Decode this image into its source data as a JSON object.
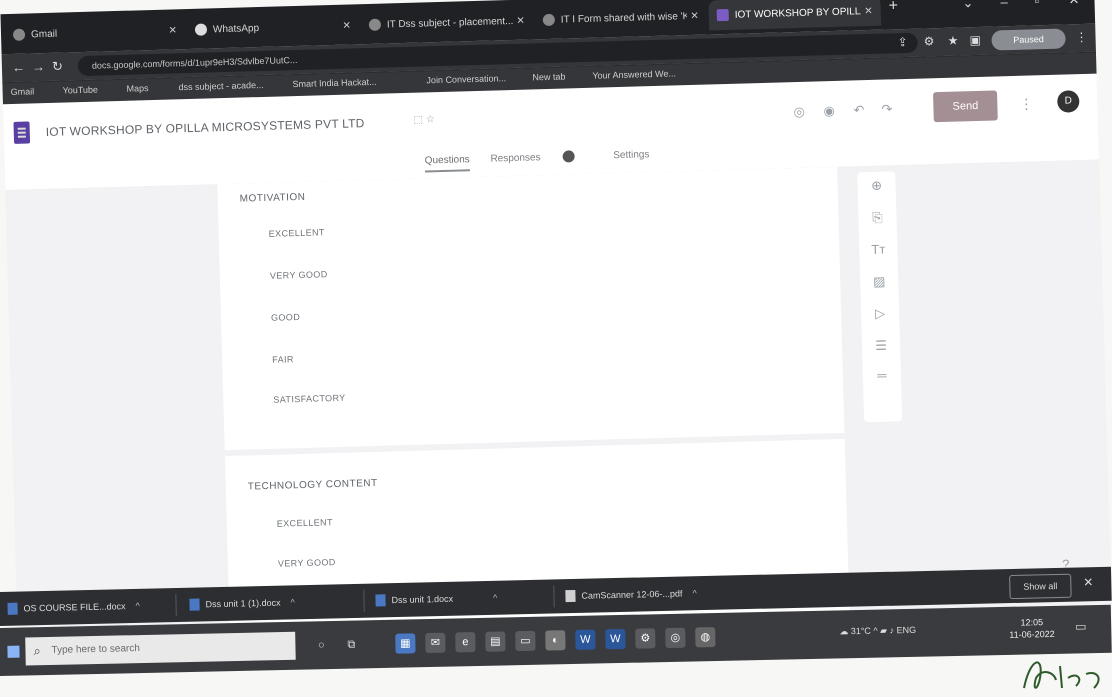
{
  "browser": {
    "tabs": [
      {
        "title": "Gmail"
      },
      {
        "title": "WhatsApp"
      },
      {
        "title": "IT Dss subject - placement..."
      },
      {
        "title": "IT I Form shared with wise 'Ka..."
      },
      {
        "title": "IOT WORKSHOP BY OPILLA..."
      }
    ],
    "url": "docs.google.com/forms/d/1upr9eH3/Sdvlbe7UutC...",
    "profile_label": "Paused",
    "bookmarks": [
      "Gmail",
      "YouTube",
      "Maps",
      "dss subject - acade...",
      "Smart India Hackat...",
      "Join Conversation...",
      "New tab",
      "Your Answered We..."
    ]
  },
  "form": {
    "title": "IOT WORKSHOP BY OPILLA MICROSYSTEMS PVT LTD",
    "send_label": "Send",
    "avatar_letter": "D",
    "tabs": {
      "questions": "Questions",
      "responses": "Responses",
      "settings": "Settings"
    },
    "questions": [
      {
        "label": "MOTIVATION",
        "options": [
          "EXCELLENT",
          "VERY GOOD",
          "GOOD",
          "FAIR",
          "SATISFACTORY"
        ]
      },
      {
        "label": "TECHNOLOGY CONTENT",
        "options": [
          "EXCELLENT",
          "VERY GOOD"
        ]
      }
    ]
  },
  "downloads": {
    "items": [
      "OS COURSE FILE...docx",
      "Dss unit 1 (1).docx",
      "Dss unit 1.docx",
      "CamScanner 12-06-...pdf"
    ],
    "show_all_label": "Show all"
  },
  "taskbar": {
    "search_placeholder": "Type here to search",
    "weather": "31°C",
    "language": "ENG",
    "time": "12:05",
    "date": "11-06-2022"
  },
  "colors": {
    "send_button": "#a38f94",
    "forms_accent": "#5a3fa3"
  }
}
